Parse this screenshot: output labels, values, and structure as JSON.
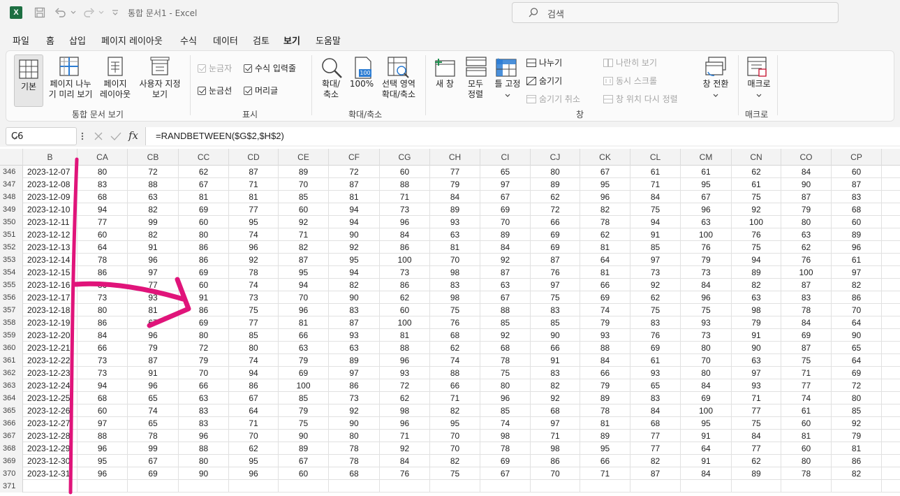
{
  "titlebar": {
    "title": "통합 문서1  -  Excel",
    "search_placeholder": "검색",
    "icons": [
      "excel-icon",
      "save-icon",
      "undo-icon",
      "redo-icon",
      "customize-icon"
    ]
  },
  "menu": {
    "tabs": [
      "파일",
      "홈",
      "삽입",
      "페이지 레이아웃",
      "수식",
      "데이터",
      "검토",
      "보기",
      "도움말"
    ],
    "active": "보기"
  },
  "ribbon": {
    "workbook_views": {
      "label": "통합 문서 보기",
      "normal": "기본",
      "page_break_1": "페이지 나누",
      "page_break_2": "기 미리 보기",
      "page_layout_1": "페이지",
      "page_layout_2": "레이아웃",
      "custom_1": "사용자 지정",
      "custom_2": "보기"
    },
    "show": {
      "label": "표시",
      "ruler": "눈금자",
      "formula_bar": "수식 입력줄",
      "gridlines": "눈금선",
      "headings": "머리글"
    },
    "zoom": {
      "label": "확대/축소",
      "zoom_1": "확대/",
      "zoom_2": "축소",
      "zoom100": "100%",
      "zoom100_icon_text": "100",
      "zoom_sel_1": "선택 영역",
      "zoom_sel_2": "확대/축소"
    },
    "window": {
      "label": "창",
      "new_window": "새 창",
      "arrange_1": "모두",
      "arrange_2": "정렬",
      "freeze": "틀 고정",
      "split": "나누기",
      "hide": "숨기기",
      "unhide": "숨기기 취소",
      "side_by_side": "나란히 보기",
      "sync_scroll": "동시 스크롤",
      "reset_pos": "창 위치 다시 정렬",
      "switch": "창 전환"
    },
    "macros": {
      "label": "매크로",
      "macros": "매크로"
    }
  },
  "formula_bar": {
    "name_box": "C6",
    "formula": "=RANDBETWEEN($G$2,$H$2)",
    "fx": "fx"
  },
  "sheet": {
    "columns": [
      "B",
      "CA",
      "CB",
      "CC",
      "CD",
      "CE",
      "CF",
      "CG",
      "CH",
      "CI",
      "CJ",
      "CK",
      "CL",
      "CM",
      "CN",
      "CO",
      "CP"
    ],
    "rows": [
      {
        "n": "346",
        "date": "2023-12-07",
        "v": [
          "80",
          "72",
          "62",
          "87",
          "89",
          "72",
          "60",
          "77",
          "65",
          "80",
          "67",
          "61",
          "61",
          "62",
          "84",
          "60"
        ]
      },
      {
        "n": "347",
        "date": "2023-12-08",
        "v": [
          "83",
          "88",
          "67",
          "71",
          "70",
          "87",
          "88",
          "79",
          "97",
          "89",
          "95",
          "71",
          "95",
          "61",
          "90",
          "87"
        ]
      },
      {
        "n": "348",
        "date": "2023-12-09",
        "v": [
          "68",
          "63",
          "81",
          "81",
          "85",
          "81",
          "71",
          "84",
          "67",
          "62",
          "96",
          "84",
          "67",
          "75",
          "87",
          "83"
        ]
      },
      {
        "n": "349",
        "date": "2023-12-10",
        "v": [
          "94",
          "82",
          "69",
          "77",
          "60",
          "94",
          "73",
          "89",
          "69",
          "72",
          "82",
          "75",
          "96",
          "92",
          "79",
          "68"
        ]
      },
      {
        "n": "350",
        "date": "2023-12-11",
        "v": [
          "77",
          "99",
          "60",
          "95",
          "92",
          "94",
          "96",
          "93",
          "70",
          "66",
          "78",
          "94",
          "63",
          "100",
          "80",
          "60"
        ]
      },
      {
        "n": "351",
        "date": "2023-12-12",
        "v": [
          "60",
          "82",
          "80",
          "74",
          "71",
          "90",
          "84",
          "63",
          "89",
          "69",
          "62",
          "91",
          "100",
          "76",
          "63",
          "89"
        ]
      },
      {
        "n": "352",
        "date": "2023-12-13",
        "v": [
          "64",
          "91",
          "86",
          "96",
          "82",
          "92",
          "86",
          "81",
          "84",
          "69",
          "81",
          "85",
          "76",
          "75",
          "62",
          "96"
        ]
      },
      {
        "n": "353",
        "date": "2023-12-14",
        "v": [
          "78",
          "96",
          "86",
          "92",
          "87",
          "95",
          "100",
          "70",
          "92",
          "87",
          "64",
          "97",
          "79",
          "94",
          "76",
          "61"
        ]
      },
      {
        "n": "354",
        "date": "2023-12-15",
        "v": [
          "86",
          "97",
          "69",
          "78",
          "95",
          "94",
          "73",
          "98",
          "87",
          "76",
          "81",
          "73",
          "73",
          "89",
          "100",
          "97"
        ]
      },
      {
        "n": "355",
        "date": "2023-12-16",
        "v": [
          "86",
          "77",
          "60",
          "74",
          "94",
          "82",
          "86",
          "83",
          "63",
          "97",
          "66",
          "92",
          "84",
          "82",
          "87",
          "82"
        ]
      },
      {
        "n": "356",
        "date": "2023-12-17",
        "v": [
          "73",
          "93",
          "91",
          "73",
          "70",
          "90",
          "62",
          "98",
          "67",
          "75",
          "69",
          "62",
          "96",
          "63",
          "83",
          "86"
        ]
      },
      {
        "n": "357",
        "date": "2023-12-18",
        "v": [
          "80",
          "81",
          "86",
          "75",
          "96",
          "83",
          "60",
          "75",
          "88",
          "83",
          "74",
          "75",
          "75",
          "98",
          "78",
          "70"
        ]
      },
      {
        "n": "358",
        "date": "2023-12-19",
        "v": [
          "86",
          "67",
          "69",
          "77",
          "81",
          "87",
          "100",
          "76",
          "85",
          "85",
          "79",
          "83",
          "93",
          "79",
          "84",
          "64"
        ]
      },
      {
        "n": "359",
        "date": "2023-12-20",
        "v": [
          "84",
          "96",
          "80",
          "85",
          "66",
          "93",
          "81",
          "68",
          "92",
          "90",
          "93",
          "76",
          "73",
          "91",
          "69",
          "90"
        ]
      },
      {
        "n": "360",
        "date": "2023-12-21",
        "v": [
          "66",
          "79",
          "72",
          "80",
          "63",
          "63",
          "88",
          "62",
          "68",
          "66",
          "88",
          "69",
          "80",
          "90",
          "87",
          "65"
        ]
      },
      {
        "n": "361",
        "date": "2023-12-22",
        "v": [
          "73",
          "87",
          "79",
          "74",
          "79",
          "89",
          "96",
          "74",
          "78",
          "91",
          "84",
          "61",
          "70",
          "63",
          "75",
          "64"
        ]
      },
      {
        "n": "362",
        "date": "2023-12-23",
        "v": [
          "73",
          "91",
          "70",
          "94",
          "69",
          "97",
          "93",
          "88",
          "75",
          "83",
          "66",
          "93",
          "80",
          "97",
          "71",
          "69"
        ]
      },
      {
        "n": "363",
        "date": "2023-12-24",
        "v": [
          "94",
          "96",
          "66",
          "86",
          "100",
          "86",
          "72",
          "66",
          "80",
          "82",
          "79",
          "65",
          "84",
          "93",
          "77",
          "72"
        ]
      },
      {
        "n": "364",
        "date": "2023-12-25",
        "v": [
          "68",
          "65",
          "63",
          "67",
          "85",
          "73",
          "62",
          "71",
          "96",
          "92",
          "89",
          "83",
          "69",
          "71",
          "74",
          "80"
        ]
      },
      {
        "n": "365",
        "date": "2023-12-26",
        "v": [
          "60",
          "74",
          "83",
          "64",
          "79",
          "92",
          "98",
          "82",
          "85",
          "68",
          "78",
          "84",
          "100",
          "77",
          "61",
          "85"
        ]
      },
      {
        "n": "366",
        "date": "2023-12-27",
        "v": [
          "97",
          "65",
          "83",
          "71",
          "75",
          "90",
          "96",
          "95",
          "74",
          "97",
          "81",
          "68",
          "95",
          "75",
          "60",
          "92"
        ]
      },
      {
        "n": "367",
        "date": "2023-12-28",
        "v": [
          "88",
          "78",
          "96",
          "70",
          "90",
          "80",
          "71",
          "70",
          "98",
          "71",
          "89",
          "77",
          "91",
          "84",
          "81",
          "79"
        ]
      },
      {
        "n": "368",
        "date": "2023-12-29",
        "v": [
          "96",
          "99",
          "88",
          "62",
          "89",
          "78",
          "92",
          "70",
          "78",
          "98",
          "95",
          "77",
          "64",
          "77",
          "60",
          "81"
        ]
      },
      {
        "n": "369",
        "date": "2023-12-30",
        "v": [
          "95",
          "67",
          "80",
          "95",
          "67",
          "78",
          "84",
          "82",
          "69",
          "86",
          "66",
          "82",
          "91",
          "62",
          "80",
          "86"
        ]
      },
      {
        "n": "370",
        "date": "2023-12-31",
        "v": [
          "96",
          "69",
          "90",
          "96",
          "60",
          "68",
          "76",
          "75",
          "67",
          "70",
          "71",
          "87",
          "84",
          "89",
          "78",
          "82"
        ]
      },
      {
        "n": "371",
        "date": "",
        "v": [
          "",
          "",
          "",
          "",
          "",
          "",
          "",
          "",
          "",
          "",
          "",
          "",
          "",
          "",
          "",
          ""
        ]
      }
    ]
  },
  "colors": {
    "accent": "#1d6f42",
    "annotation": "#e0147a"
  }
}
